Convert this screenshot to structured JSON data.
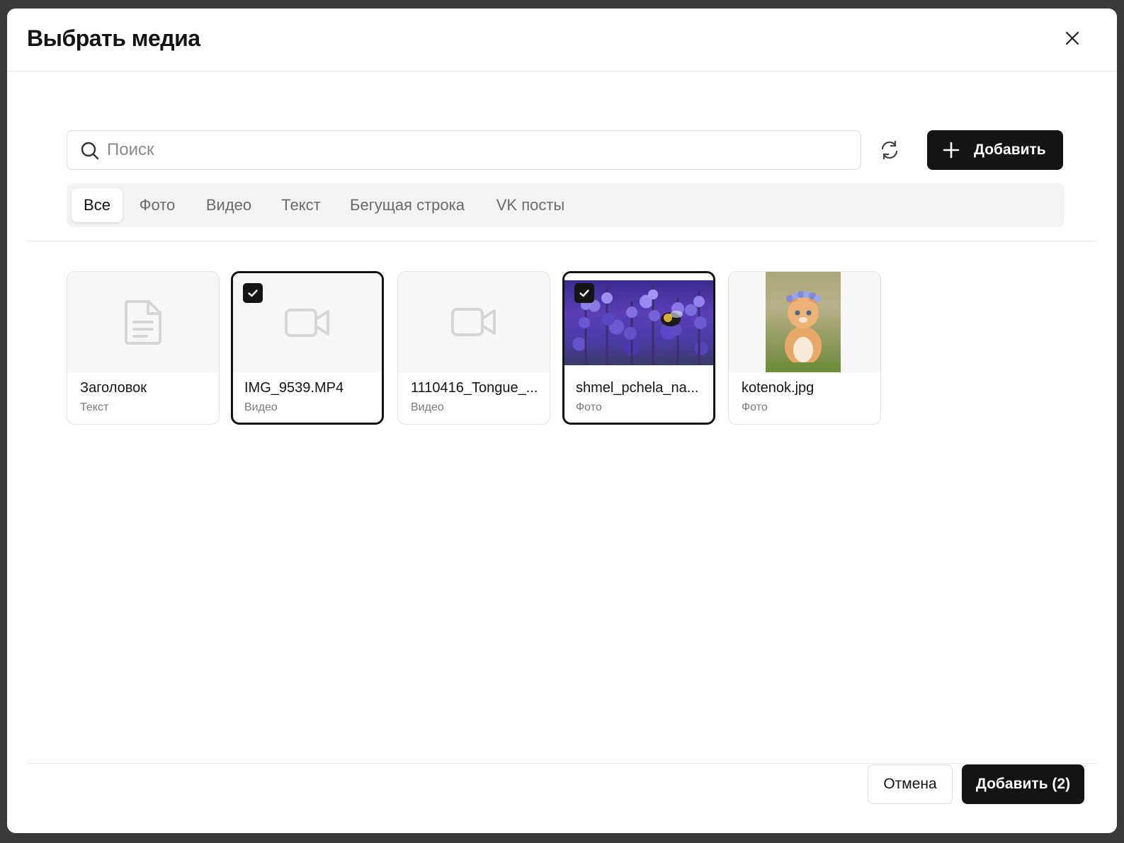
{
  "modal": {
    "title": "Выбрать медиа"
  },
  "search": {
    "placeholder": "Поиск",
    "value": ""
  },
  "toolbar": {
    "add_label": "Добавить"
  },
  "tabs": [
    {
      "label": "Все",
      "active": true
    },
    {
      "label": "Фото",
      "active": false
    },
    {
      "label": "Видео",
      "active": false
    },
    {
      "label": "Текст",
      "active": false
    },
    {
      "label": "Бегущая строка",
      "active": false
    },
    {
      "label": "VK посты",
      "active": false
    }
  ],
  "media": [
    {
      "name": "Заголовок",
      "type": "Текст",
      "selected": false,
      "thumb": "document-icon"
    },
    {
      "name": "IMG_9539.MP4",
      "type": "Видео",
      "selected": true,
      "thumb": "video-camera-icon"
    },
    {
      "name": "1110416_Tongue_...",
      "type": "Видео",
      "selected": false,
      "thumb": "video-camera-icon"
    },
    {
      "name": "shmel_pchela_na...",
      "type": "Фото",
      "selected": true,
      "thumb": "photo"
    },
    {
      "name": "kotenok.jpg",
      "type": "Фото",
      "selected": false,
      "thumb": "photo"
    }
  ],
  "footer": {
    "cancel_label": "Отмена",
    "confirm_label": "Добавить (2)"
  },
  "colors": {
    "primary": "#141414",
    "tab_bar_bg": "#f3f3f3",
    "muted_text": "#7a7a7a",
    "border": "#e3e3e3"
  }
}
